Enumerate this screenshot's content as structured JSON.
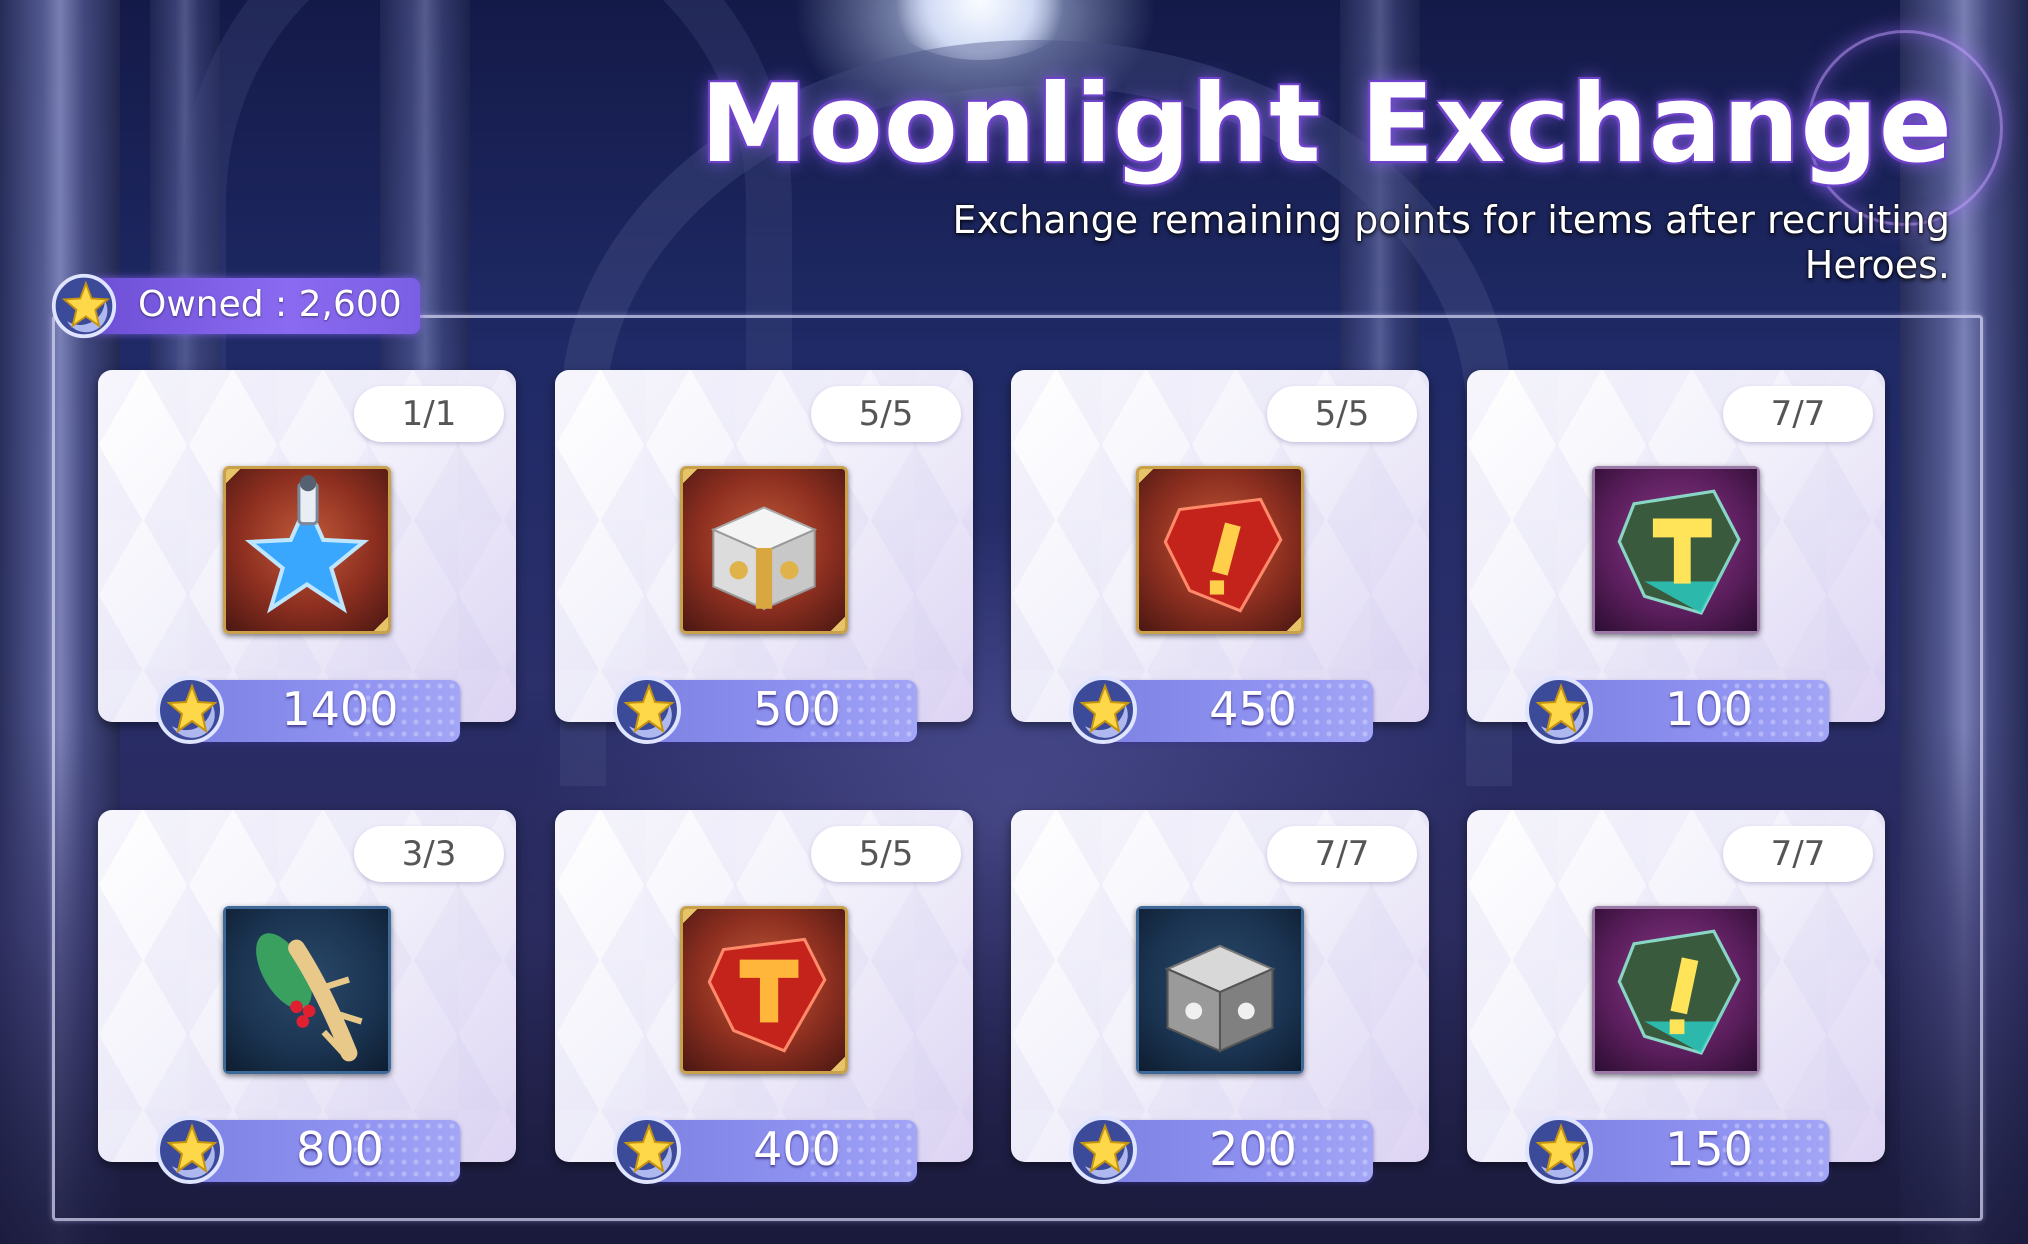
{
  "header": {
    "title": "Moonlight Exchange",
    "subtitle": "Exchange remaining points for items after recruiting Heroes."
  },
  "owned": {
    "label": "Owned : 2,600"
  },
  "colors": {
    "accent": "#7c5ee6",
    "price_bar": "#8a8ef0",
    "title_outline": "#6a3fc4"
  },
  "items": [
    {
      "limit": "1/1",
      "price": "1400",
      "icon": "blue-star-potion-icon"
    },
    {
      "limit": "5/5",
      "price": "500",
      "icon": "white-gold-chest-icon"
    },
    {
      "limit": "5/5",
      "price": "450",
      "icon": "red-exclamation-crystal-icon"
    },
    {
      "limit": "7/7",
      "price": "100",
      "icon": "teal-hammer-crystal-icon"
    },
    {
      "limit": "3/3",
      "price": "800",
      "icon": "ginseng-root-icon"
    },
    {
      "limit": "5/5",
      "price": "400",
      "icon": "red-hammer-crystal-icon"
    },
    {
      "limit": "7/7",
      "price": "200",
      "icon": "silver-chest-icon"
    },
    {
      "limit": "7/7",
      "price": "150",
      "icon": "teal-exclamation-crystal-icon"
    }
  ]
}
